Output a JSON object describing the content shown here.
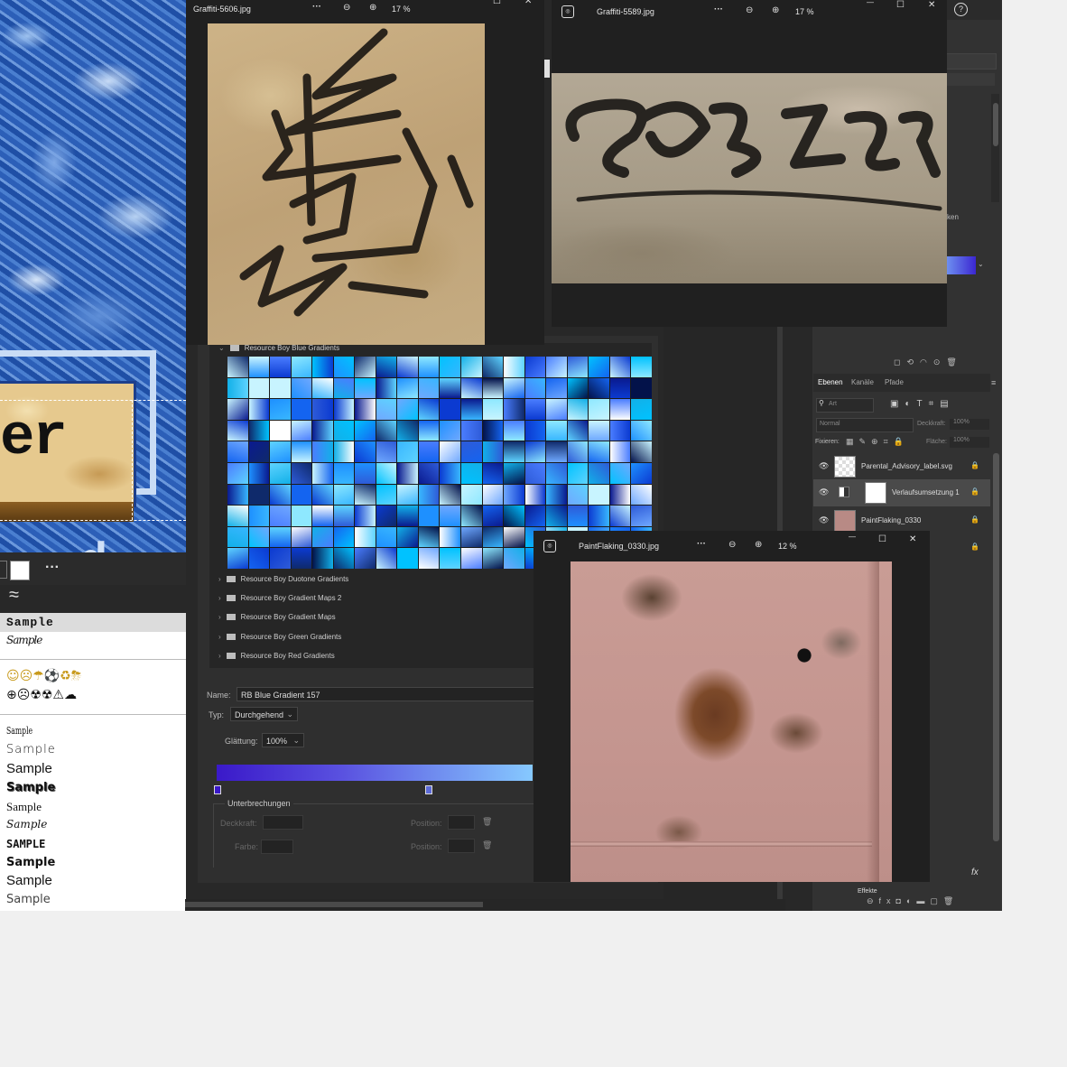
{
  "ps": {
    "blue_canvas_fragment": "er",
    "blue_canvas_letter": "d",
    "font_panel": {
      "approx_glyph": "≈",
      "more": "···",
      "samples": [
        "Sample",
        "Sample",
        "Sample",
        "Sample",
        "Sample",
        "Sample",
        "Sample",
        "Sample",
        "Sample",
        "Sample",
        "Sample"
      ],
      "top_sample": "Sample",
      "top_script": "Sample",
      "emoji_row1": "☺☹☂⚽♻⛈",
      "emoji_row2": "⊕☹☢☢⚠☁"
    },
    "layers_panel": {
      "tabs": [
        "Ebenen",
        "Kanäle",
        "Pfade"
      ],
      "search_placeholder": "Art",
      "blend_mode": "Normal",
      "opacity_label": "Deckkraft:",
      "opacity_value": "100%",
      "fix_label": "Fixieren:",
      "fill_label": "Fläche:",
      "fill_value": "100%",
      "partial_label": "ken",
      "layers": [
        {
          "name": "Parental_Advisory_label.svg"
        },
        {
          "name": "Verlaufsumsetzung 1"
        },
        {
          "name": "PaintFlaking_0330"
        },
        {
          "name": ""
        }
      ],
      "effects_label": "Effekte",
      "fx": "fx"
    },
    "gradient_editor": {
      "top_folder": "Resource Boy Blue Gradients",
      "folders": [
        "Resource Boy Duotone Gradients",
        "Resource Boy Gradient Maps 2",
        "Resource Boy Gradient Maps",
        "Resource Boy Green Gradients",
        "Resource Boy Red Gradients"
      ],
      "name_label": "Name:",
      "name_value": "RB Blue Gradient 157",
      "type_label": "Typ:",
      "type_value": "Durchgehend",
      "smooth_label": "Glättung:",
      "smooth_value": "100%",
      "stops_group": "Unterbrechungen",
      "opacity_label": "Deckkraft:",
      "position_label": "Position:",
      "color_label": "Farbe:",
      "gradient_colors": [
        "#3a19c9",
        "#86c9ff"
      ]
    }
  },
  "viewers": [
    {
      "title": "Graffiti-5606.jpg",
      "zoom": "17 %",
      "more": "···"
    },
    {
      "title": "Graffiti-5589.jpg",
      "zoom": "17 %",
      "more": "···"
    },
    {
      "title": "PaintFlaking_0330.jpg",
      "zoom": "12 %",
      "more": "···"
    }
  ],
  "icons": {
    "minimize": "—",
    "maximize": "☐",
    "close": "✕",
    "zoom_out": "⊖",
    "zoom_in": "⊕",
    "help": "?"
  }
}
